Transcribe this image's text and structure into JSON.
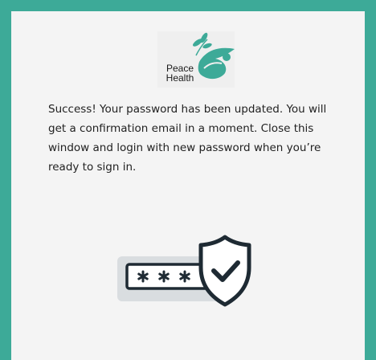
{
  "brand": {
    "logo_line1": "Peace",
    "logo_line2": "Health",
    "logo_icon": "dove-icon",
    "accent_color": "#3daa98"
  },
  "message": {
    "text": "Success! Your password has been updated. You will get a confirmation email in a moment. Close this window and login with new password when you’re ready to sign in."
  },
  "illustration": {
    "icon": "password-shield-check-icon",
    "masked_text": "* * *"
  }
}
